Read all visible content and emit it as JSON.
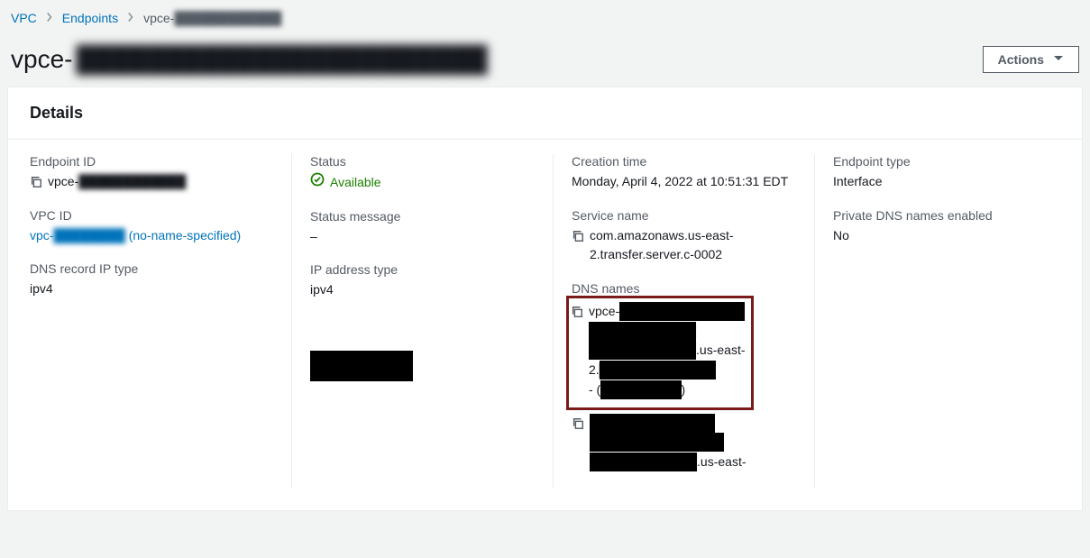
{
  "breadcrumb": {
    "root": "VPC",
    "section": "Endpoints",
    "current_prefix": "vpce-",
    "current_redacted": "████████████"
  },
  "header": {
    "title_prefix": "vpce-",
    "title_redacted": "███████████████████████",
    "actions_label": "Actions"
  },
  "panel": {
    "title": "Details"
  },
  "details": {
    "col1": {
      "endpoint_id_label": "Endpoint ID",
      "endpoint_id_prefix": "vpce-",
      "endpoint_id_redacted": "████████████",
      "vpc_id_label": "VPC ID",
      "vpc_id_prefix": "vpc-",
      "vpc_id_redacted": "████████",
      "vpc_id_suffix": " (no-name-specified)",
      "dns_record_ip_type_label": "DNS record IP type",
      "dns_record_ip_type_value": "ipv4"
    },
    "col2": {
      "status_label": "Status",
      "status_value": "Available",
      "status_message_label": "Status message",
      "status_message_value": "–",
      "ip_address_type_label": "IP address type",
      "ip_address_type_value": "ipv4"
    },
    "col3": {
      "creation_time_label": "Creation time",
      "creation_time_value": "Monday, April 4, 2022 at 10:51:31 EDT",
      "service_name_label": "Service name",
      "service_name_value": "com.amazonaws.us-east-2.transfer.server.c-0002",
      "dns_names_label": "DNS names",
      "dns1_p1": "vpce-",
      "dns1_r1": "██████████████",
      "dns1_r2": "████████████",
      "dns1_r3": "████████████",
      "dns1_p2": ".us-east-",
      "dns1_p3": "2.",
      "dns1_r4": "█████████████",
      "dns1_p4": "- (",
      "dns1_r5": "█████████",
      "dns1_p5": ")",
      "dns2_r1": "██████████████",
      "dns2_r2": "███████████████",
      "dns2_r3": "████████████",
      "dns2_p1": ".us-east-"
    },
    "col4": {
      "endpoint_type_label": "Endpoint type",
      "endpoint_type_value": "Interface",
      "private_dns_label": "Private DNS names enabled",
      "private_dns_value": "No"
    }
  }
}
